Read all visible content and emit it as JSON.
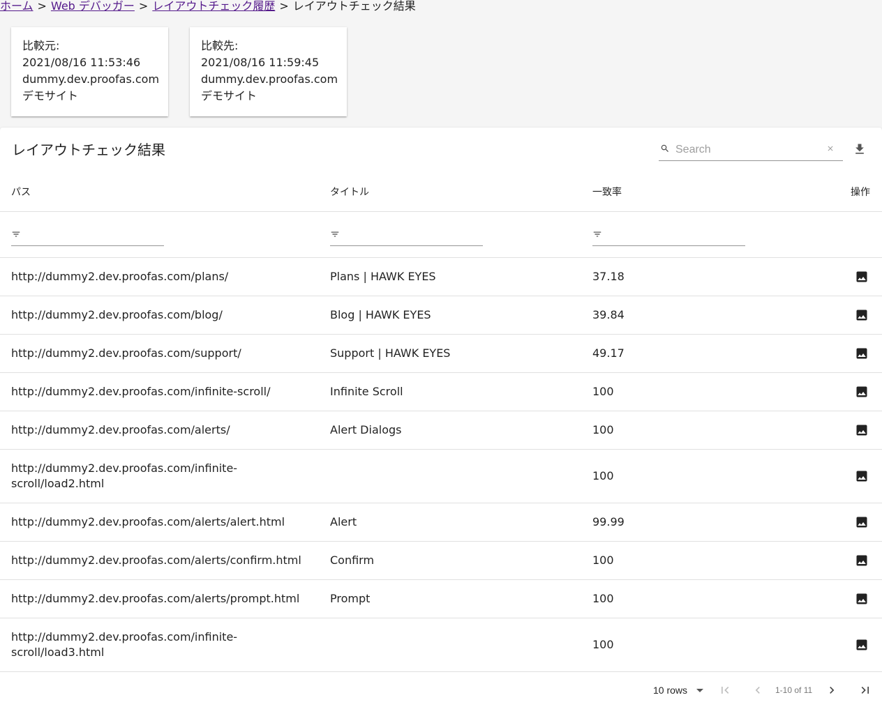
{
  "breadcrumb": {
    "items": [
      "ホーム",
      "Web デバッガー",
      "レイアウトチェック履歴"
    ],
    "separator": ">",
    "current": "レイアウトチェック結果"
  },
  "compare_cards": [
    {
      "label": "比較元:",
      "datetime": "2021/08/16 11:53:46",
      "host": "dummy.dev.proofas.com",
      "site": "デモサイト"
    },
    {
      "label": "比較先:",
      "datetime": "2021/08/16 11:59:45",
      "host": "dummy.dev.proofas.com",
      "site": "デモサイト"
    }
  ],
  "table": {
    "title": "レイアウトチェック結果",
    "search_placeholder": "Search",
    "columns": {
      "path": "パス",
      "title": "タイトル",
      "match": "一致率",
      "action": "操作"
    },
    "rows": [
      {
        "path": "http://dummy2.dev.proofas.com/plans/",
        "title": "Plans | HAWK EYES",
        "match": "37.18"
      },
      {
        "path": "http://dummy2.dev.proofas.com/blog/",
        "title": "Blog | HAWK EYES",
        "match": "39.84"
      },
      {
        "path": "http://dummy2.dev.proofas.com/support/",
        "title": "Support | HAWK EYES",
        "match": "49.17"
      },
      {
        "path": "http://dummy2.dev.proofas.com/infinite-scroll/",
        "title": "Infinite Scroll",
        "match": "100"
      },
      {
        "path": "http://dummy2.dev.proofas.com/alerts/",
        "title": "Alert Dialogs",
        "match": "100"
      },
      {
        "path": "http://dummy2.dev.proofas.com/infinite-scroll/load2.html",
        "title": "",
        "match": "100"
      },
      {
        "path": "http://dummy2.dev.proofas.com/alerts/alert.html",
        "title": "Alert",
        "match": "99.99"
      },
      {
        "path": "http://dummy2.dev.proofas.com/alerts/confirm.html",
        "title": "Confirm",
        "match": "100"
      },
      {
        "path": "http://dummy2.dev.proofas.com/alerts/prompt.html",
        "title": "Prompt",
        "match": "100"
      },
      {
        "path": "http://dummy2.dev.proofas.com/infinite-scroll/load3.html",
        "title": "",
        "match": "100"
      }
    ],
    "path_lines": {
      "5": [
        "http://dummy2.dev.proofas.com/infinite-",
        "scroll/load2.html"
      ],
      "9": [
        "http://dummy2.dev.proofas.com/infinite-",
        "scroll/load3.html"
      ]
    }
  },
  "pagination": {
    "rows_per_page": "10 rows",
    "page_info": "1-10 of 11"
  },
  "icons": {
    "search": "search-icon",
    "clear": "clear-icon",
    "download": "download-icon",
    "filter": "filter-icon",
    "image": "image-icon",
    "first_page": "first-page-icon",
    "prev_page": "chevron-left-icon",
    "next_page": "chevron-right-icon",
    "last_page": "last-page-icon"
  }
}
